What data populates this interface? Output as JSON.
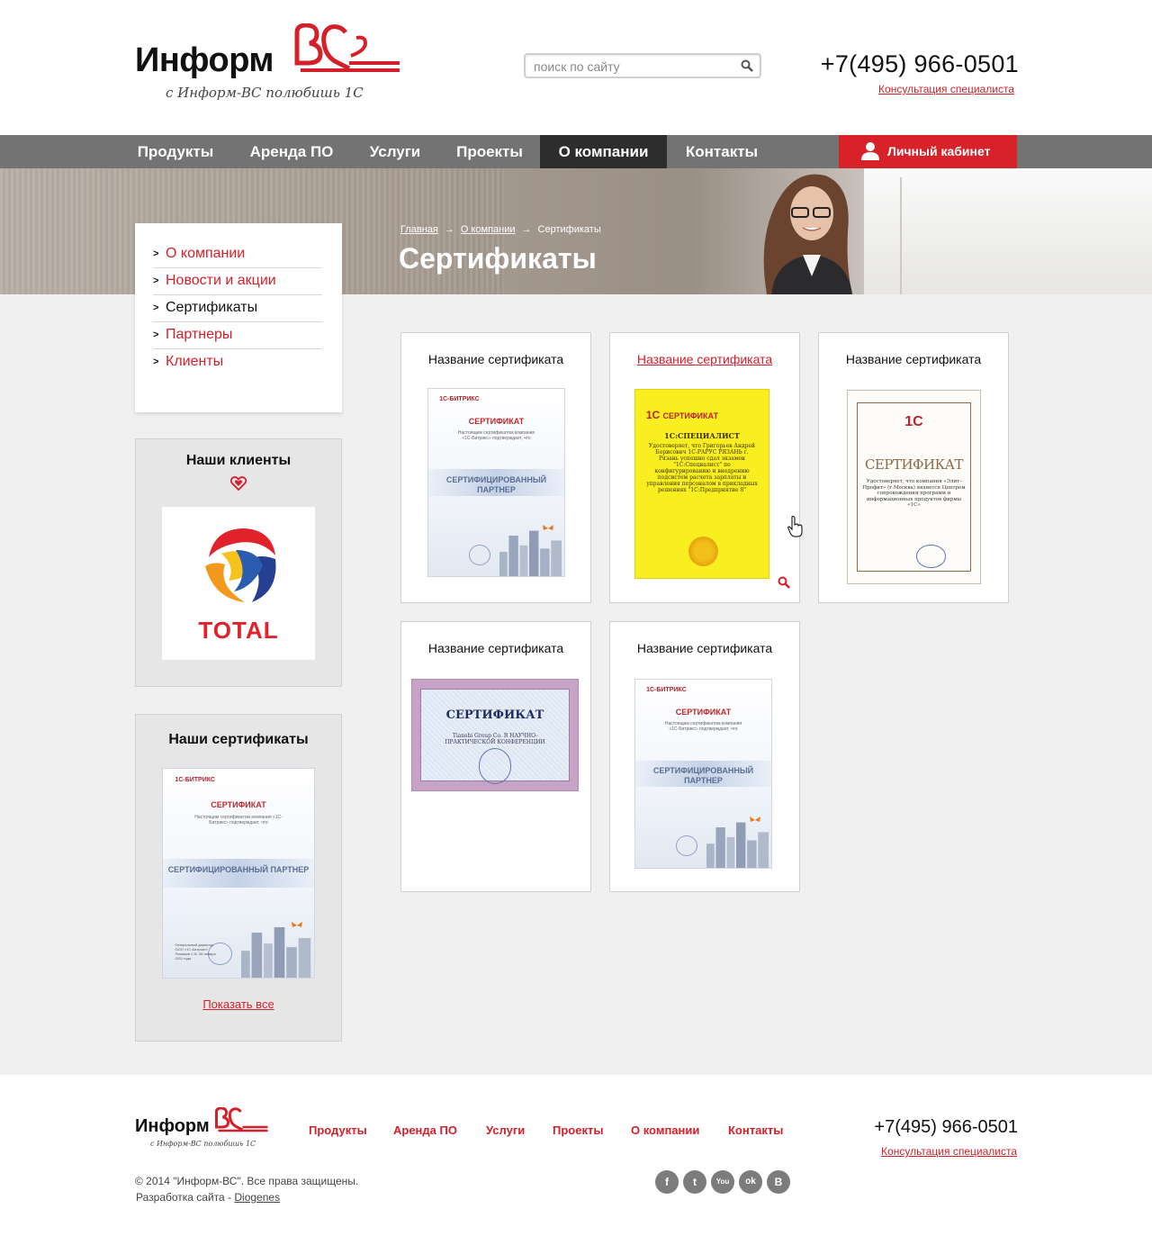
{
  "header": {
    "logo_text": "Информ",
    "logo_slogan": "с Информ-ВС полюбишь 1С",
    "search_placeholder": "поиск по сайту",
    "phone": "+7(495) 966-0501",
    "consult_link": "Консультация специалиста"
  },
  "nav": {
    "items": [
      {
        "label": "Продукты"
      },
      {
        "label": "Аренда ПО"
      },
      {
        "label": "Услуги"
      },
      {
        "label": "Проекты"
      },
      {
        "label": "О компании"
      },
      {
        "label": "Контакты"
      }
    ],
    "active": "О компании",
    "cabinet_label": "Личный кабинет"
  },
  "breadcrumb": {
    "items": [
      "Главная",
      "О компании",
      "Сертификаты"
    ]
  },
  "page_title": "Сертификаты",
  "side_menu": {
    "items": [
      {
        "label": "О компании"
      },
      {
        "label": "Новости и акции"
      },
      {
        "label": "Сертификаты"
      },
      {
        "label": "Партнеры"
      },
      {
        "label": "Клиенты"
      }
    ],
    "active": "Сертификаты"
  },
  "clients_box": {
    "title": "Наши клиенты",
    "client_logo_text": "TOTAL"
  },
  "certs_box": {
    "title": "Наши сертификаты",
    "show_all": "Показать все"
  },
  "certificates": [
    {
      "title": "Название сертификата"
    },
    {
      "title": "Название сертификата"
    },
    {
      "title": "Название сертификата"
    },
    {
      "title": "Название сертификата"
    },
    {
      "title": "Название сертификата"
    }
  ],
  "cert_texts": {
    "bitrix_logo": "1С-БИТРИКС",
    "bitrix_title": "СЕРТИФИКАТ",
    "bitrix_line": "Настоящим сертификатом компания «1С-Битрикс» подтверждает, что",
    "bitrix_partner": "СЕРТИФИЦИРОВАННЫЙ ПАРТНЕР",
    "bitrix_small": "Генеральный директор ООО «1С-Битрикс» Рыжиков С.В. 06 января 2011 года",
    "yellow_brand": "1С",
    "yellow_title": "СЕРТИФИКАТ",
    "yellow_spec": "1С:СПЕЦИАЛИСТ",
    "yellow_lines": "Удостоверяет, что Григорьев Андрей Борисович 1С-РАРУС РЯЗАНЬ г. Рязань успешно сдал экзамен \"1С:Специалист\" по конфигурированию и внедрению подсистем расчета зарплаты и управления персоналом в прикладных решениях \"1С:Предприятие 8\"",
    "brown_logo": "1С",
    "brown_title": "СЕРТИФИКАТ",
    "brown_lines": "Удостоверяет, что компания «Элит-Профит» (г.Москва) является Центром сопровождения программ и информационных продуктов фирмы «1С»",
    "guilloche_title": "СЕРТИФИКАТ",
    "guilloche_lines": "Tianshi Group Co. В НАУЧНО-ПРАКТИЧЕСКОЙ КОНФЕРЕНЦИИ"
  },
  "footer": {
    "logo_text": "Информ",
    "logo_slogan": "с Информ-ВС полюбишь 1С",
    "nav": [
      "Продукты",
      "Аренда ПО",
      "Услуги",
      "Проекты",
      "О компании",
      "Контакты"
    ],
    "phone": "+7(495) 966-0501",
    "consult_link": "Консультация специалиста",
    "copyright": "© 2014 \"Информ-ВС\". Все права защищены.",
    "dev_prefix": "Разработка сайта - ",
    "dev_link": "Diogenes",
    "social": [
      {
        "icon": "facebook-icon",
        "glyph": "f"
      },
      {
        "icon": "twitter-icon",
        "glyph": "t"
      },
      {
        "icon": "youtube-icon",
        "glyph": "You"
      },
      {
        "icon": "odnoklassniki-icon",
        "glyph": "ok"
      },
      {
        "icon": "vkontakte-icon",
        "glyph": "B"
      }
    ]
  },
  "colors": {
    "accent_red": "#d4202a",
    "nav_gray": "#737373",
    "nav_active": "#2d2d2d",
    "page_bg": "#f0f0f0"
  }
}
